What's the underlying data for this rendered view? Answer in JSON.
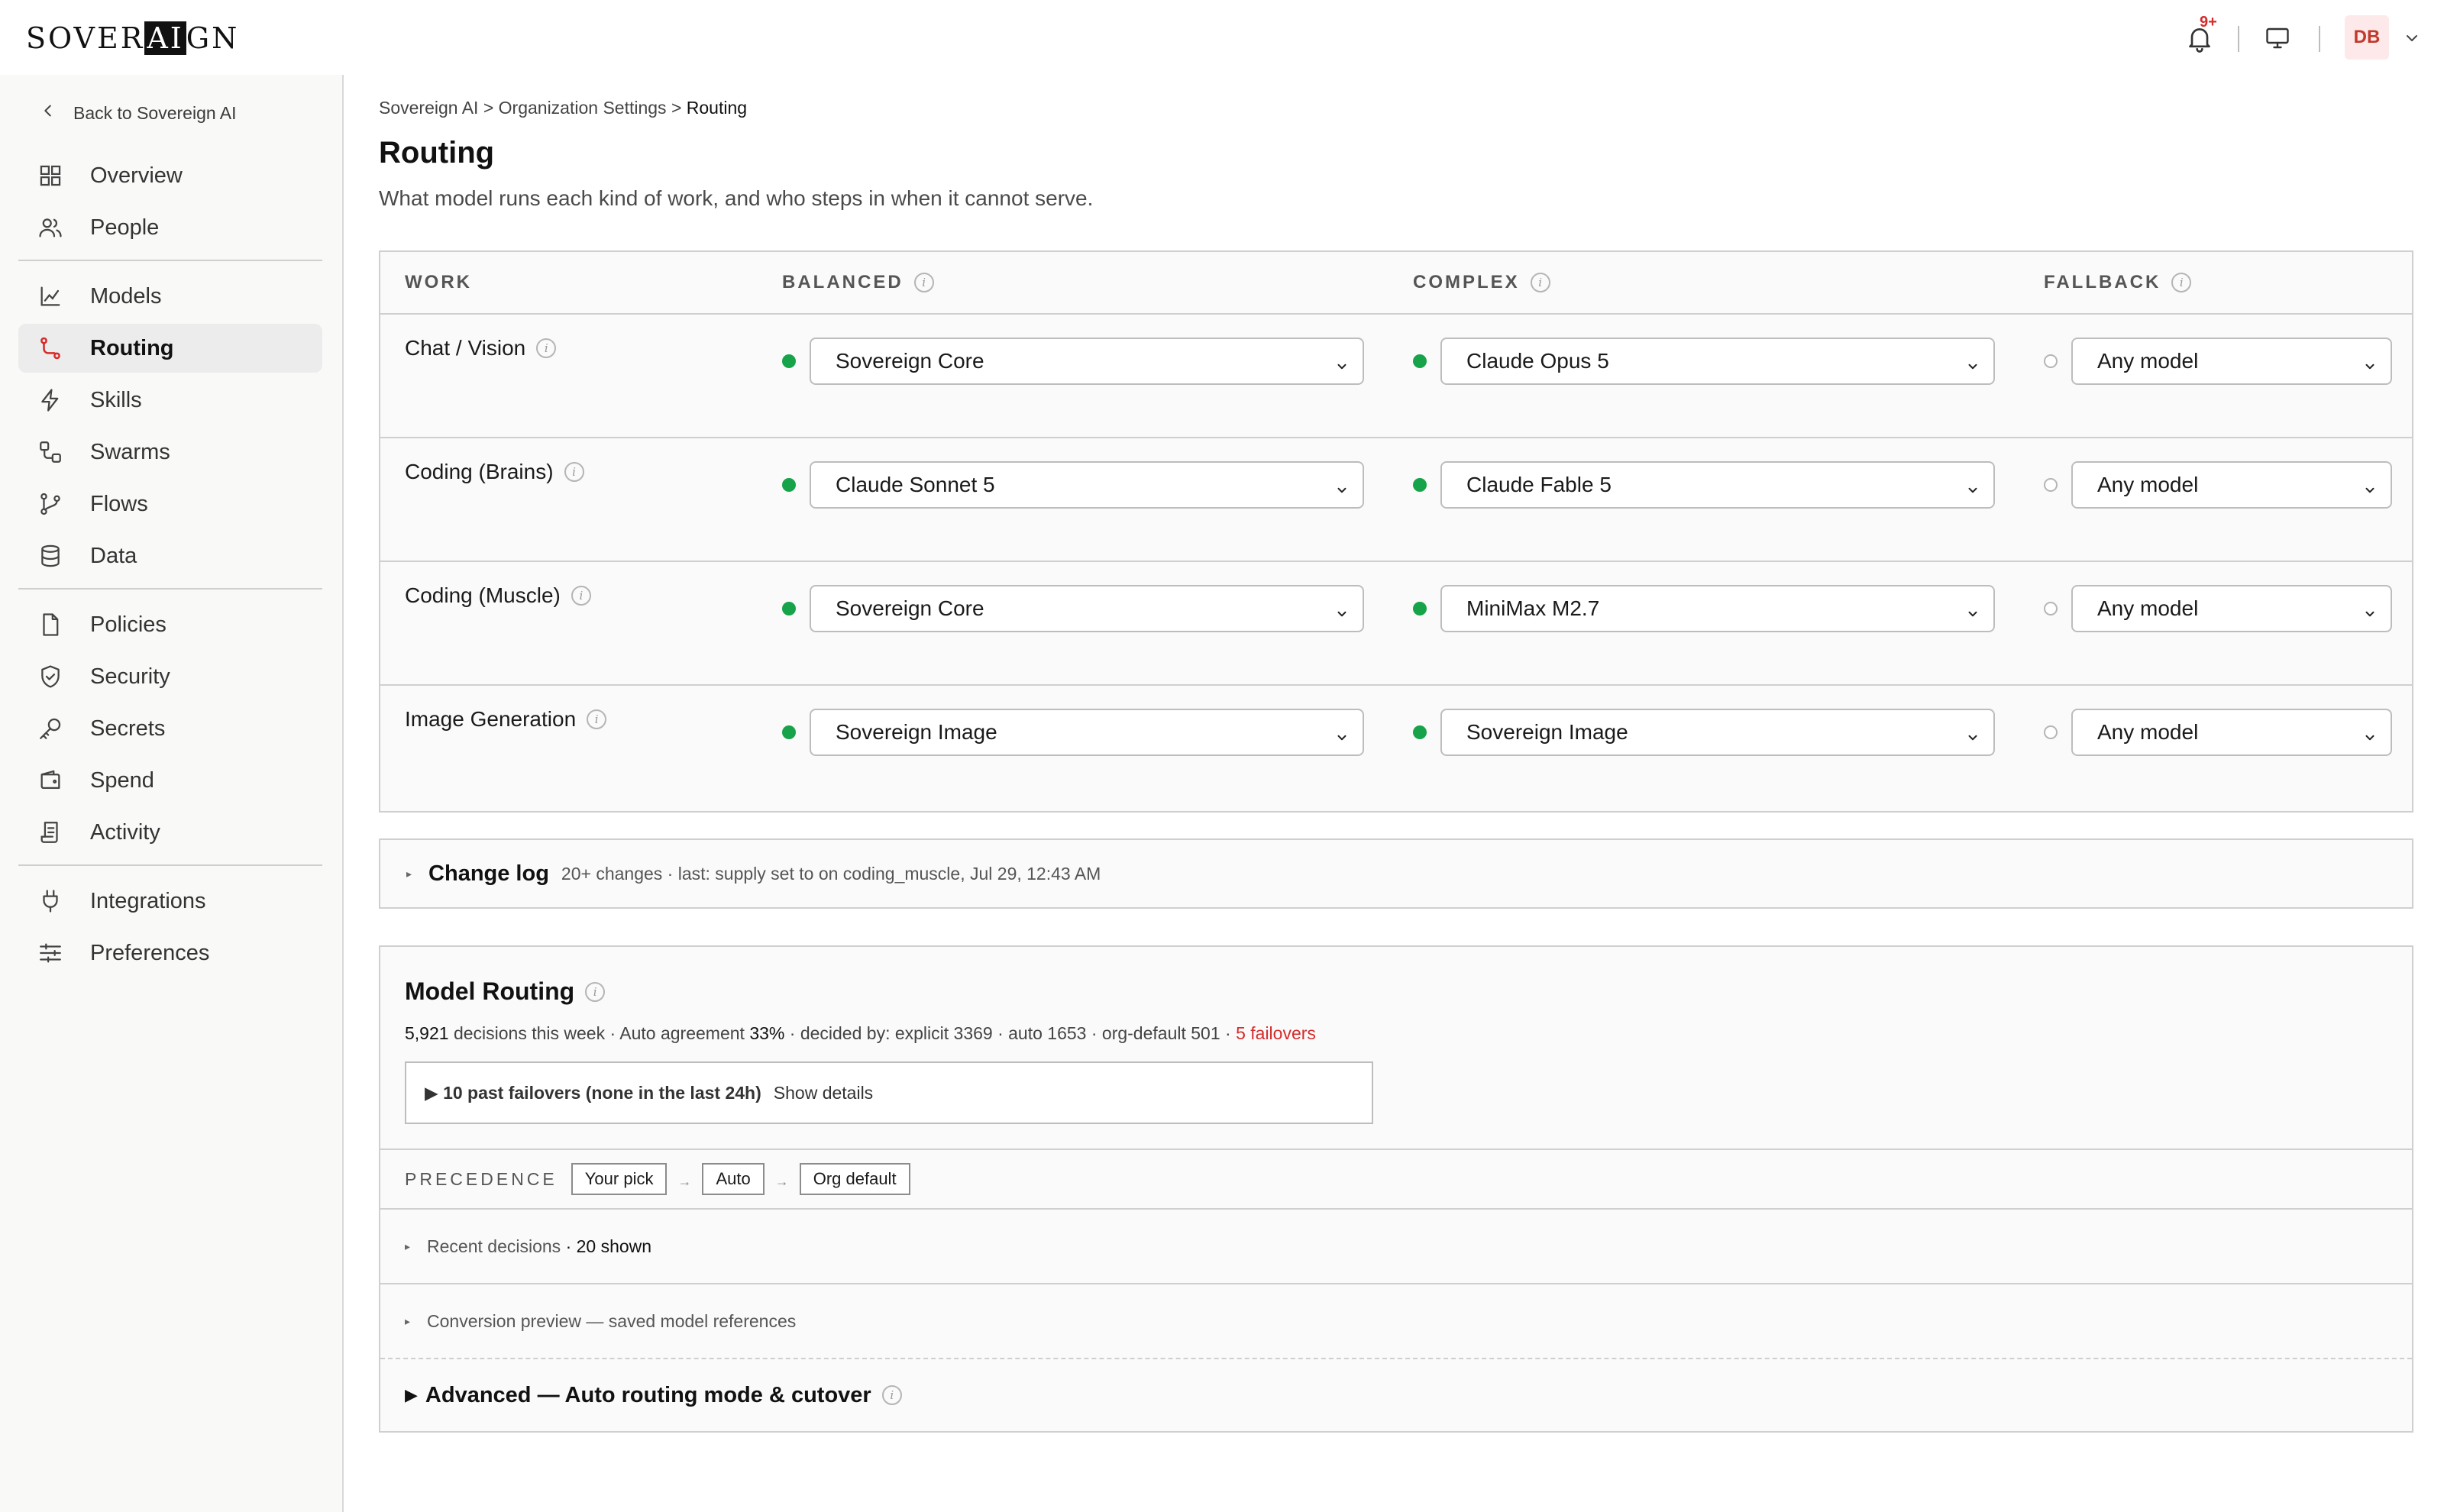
{
  "brand": {
    "logo_pre": "SOVER",
    "logo_inv": "AI",
    "logo_post": "GN"
  },
  "topbar": {
    "notification_badge": "9+",
    "avatar_initials": "DB"
  },
  "sidebar": {
    "back_label": "Back to Sovereign AI",
    "items": [
      {
        "label": "Overview",
        "icon": "grid-icon"
      },
      {
        "label": "People",
        "icon": "people-icon"
      },
      {
        "label": "Models",
        "icon": "models-icon"
      },
      {
        "label": "Routing",
        "icon": "route-icon",
        "active": true
      },
      {
        "label": "Skills",
        "icon": "bolt-icon"
      },
      {
        "label": "Swarms",
        "icon": "swarm-icon"
      },
      {
        "label": "Flows",
        "icon": "branch-icon"
      },
      {
        "label": "Data",
        "icon": "database-icon"
      },
      {
        "label": "Policies",
        "icon": "document-icon"
      },
      {
        "label": "Security",
        "icon": "shield-icon"
      },
      {
        "label": "Secrets",
        "icon": "key-icon"
      },
      {
        "label": "Spend",
        "icon": "wallet-icon"
      },
      {
        "label": "Activity",
        "icon": "receipt-icon"
      },
      {
        "label": "Integrations",
        "icon": "plug-icon"
      },
      {
        "label": "Preferences",
        "icon": "sliders-icon"
      }
    ]
  },
  "breadcrumb": {
    "part1": "Sovereign AI",
    "sep": ">",
    "part2": "Organization Settings",
    "current": "Routing"
  },
  "page": {
    "title": "Routing",
    "subtitle": "What model runs each kind of work, and who steps in when it cannot serve."
  },
  "routing_table": {
    "headers": {
      "work": "WORK",
      "balanced": "BALANCED",
      "complex": "COMPLEX",
      "fallback": "FALLBACK"
    },
    "rows": [
      {
        "work": "Chat / Vision",
        "balanced": "Sovereign Core",
        "complex": "Claude Opus 5",
        "fallback": "Any model"
      },
      {
        "work": "Coding (Brains)",
        "balanced": "Claude Sonnet 5",
        "complex": "Claude Fable 5",
        "fallback": "Any model"
      },
      {
        "work": "Coding (Muscle)",
        "balanced": "Sovereign Core",
        "complex": "MiniMax M2.7",
        "fallback": "Any model"
      },
      {
        "work": "Image Generation",
        "balanced": "Sovereign Image",
        "complex": "Sovereign Image",
        "fallback": "Any model"
      }
    ],
    "status_color_active": "#17a34a"
  },
  "change_log": {
    "title": "Change log",
    "meta": "20+ changes · last: supply set to on coding_muscle, Jul 29, 12:43 AM"
  },
  "model_routing": {
    "title": "Model Routing",
    "stats": {
      "decisions": "5,921",
      "decisions_label": "decisions this week · Auto agreement",
      "agreement": "33%",
      "decided_by": "· decided by: explicit 3369 · auto 1653 · org-default 501 ·",
      "failovers": "5 failovers"
    },
    "failovers_box": {
      "summary": "10 past failovers (none in the last 24h)",
      "link": "Show details"
    },
    "precedence": {
      "label": "PRECEDENCE",
      "steps": [
        "Your pick",
        "Auto",
        "Org default"
      ]
    },
    "recent": {
      "label": "Recent decisions",
      "count": "· 20 shown"
    },
    "conversion": "Conversion preview — saved model references",
    "advanced": "Advanced — Auto routing mode & cutover"
  }
}
